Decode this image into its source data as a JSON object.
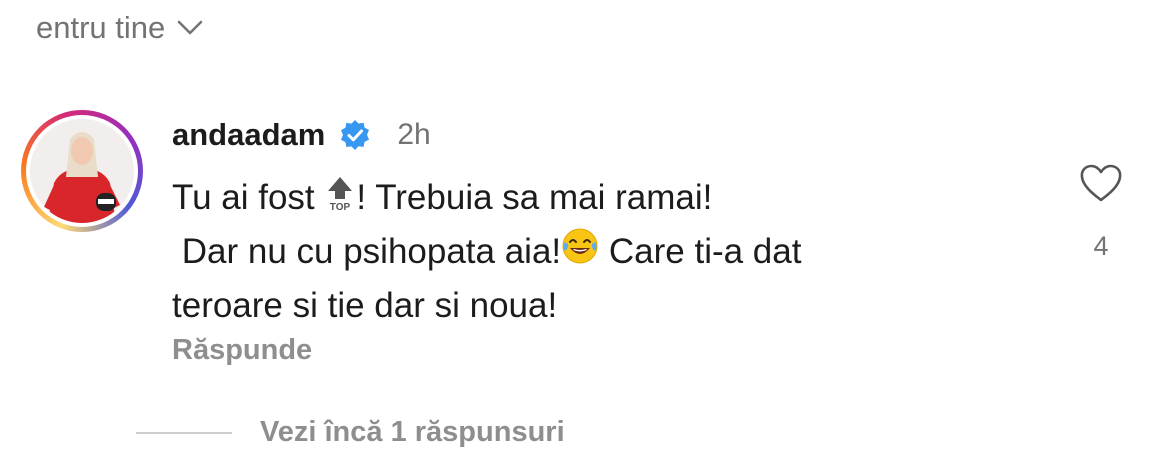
{
  "header": {
    "sort_label": "entru tine",
    "sort_icon": "chevron-down-icon"
  },
  "comment": {
    "username": "andaadam",
    "verified_icon": "verified-badge-icon",
    "time": "2h",
    "text_part1": "Tu ai fost ",
    "top_emoji": "TOP",
    "text_part2": "! Trebuia sa mai ramai!\n Dar nu cu psihopata aia!",
    "laugh_emoji": "face-with-tears-of-joy-icon",
    "text_part3": " Care ti-a dat\nteroare si tie dar si noua!",
    "reply_label": "Răspunde",
    "like_icon": "heart-outline-icon",
    "like_count": "4",
    "view_replies_label": "Vezi încă 1 răspunsuri"
  },
  "colors": {
    "text_primary": "#1c1c1c",
    "text_secondary": "#737373",
    "verified_blue": "#3897f0",
    "avatar_outfit": "#d9262b"
  }
}
